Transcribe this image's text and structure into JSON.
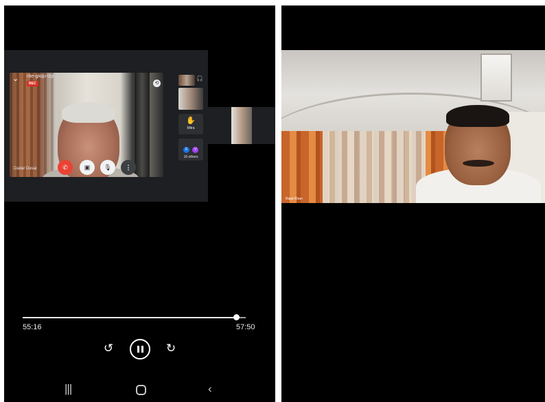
{
  "left_phone": {
    "call": {
      "meeting_code": "rbe-gkqu-tzp",
      "rec_badge": "REC",
      "name_tag": "Dadar Desai",
      "side_panel": {
        "raise_hand_label": "Mitra",
        "others_label": "16 others",
        "avatar_1": "S",
        "avatar_2": "V"
      }
    },
    "player": {
      "elapsed": "55:16",
      "duration": "57:50",
      "progress": 0.956,
      "rewind_label": "10",
      "forward_label": "10"
    }
  },
  "right_phone": {
    "name_tag": "Rajat Khan"
  }
}
